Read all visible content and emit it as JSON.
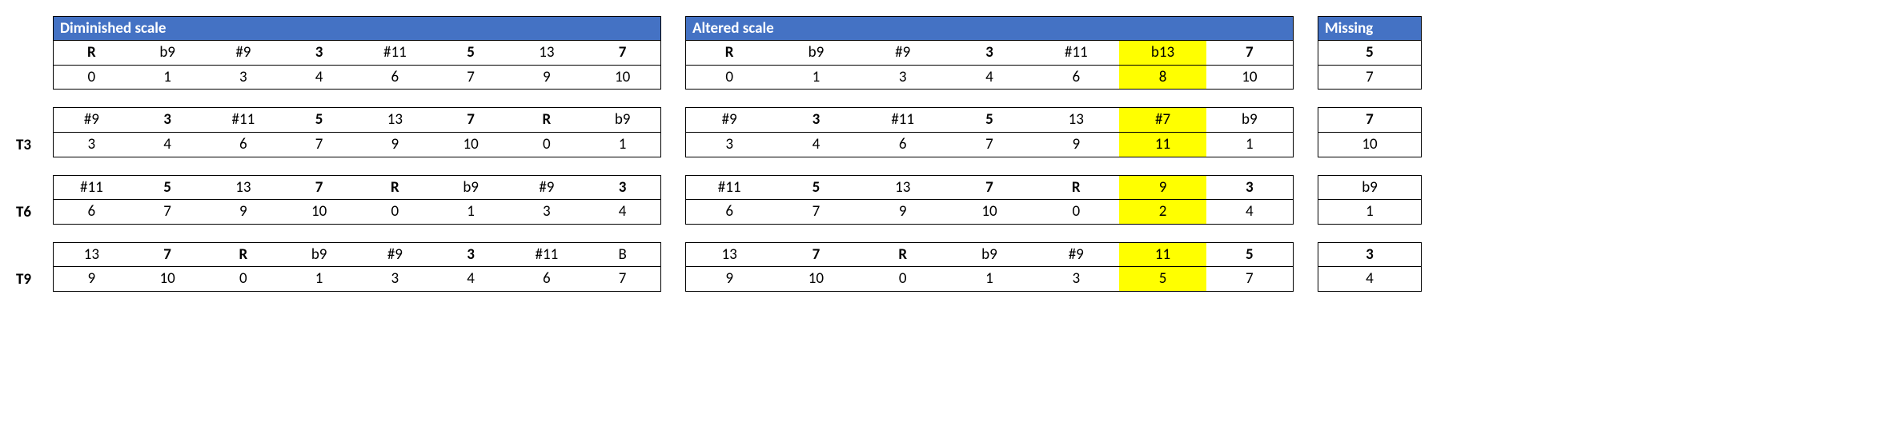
{
  "headers": {
    "diminished": "Diminished scale",
    "altered": "Altered scale",
    "missing": "Missing"
  },
  "row_labels": {
    "r0": "",
    "r1": "T3",
    "r2": "T6",
    "r3": "T9"
  },
  "groups": [
    {
      "label_key": "r0",
      "dim": {
        "top": [
          {
            "t": "R",
            "b": true
          },
          {
            "t": "b9"
          },
          {
            "t": "#9"
          },
          {
            "t": "3",
            "b": true
          },
          {
            "t": "#11"
          },
          {
            "t": "5",
            "b": true
          },
          {
            "t": "13"
          },
          {
            "t": "7",
            "b": true
          }
        ],
        "bot": [
          {
            "t": "0"
          },
          {
            "t": "1"
          },
          {
            "t": "3"
          },
          {
            "t": "4"
          },
          {
            "t": "6"
          },
          {
            "t": "7"
          },
          {
            "t": "9"
          },
          {
            "t": "10"
          }
        ]
      },
      "alt": {
        "top": [
          {
            "t": "R",
            "b": true
          },
          {
            "t": "b9"
          },
          {
            "t": "#9"
          },
          {
            "t": "3",
            "b": true
          },
          {
            "t": "#11"
          },
          {
            "t": "b13",
            "hl": true
          },
          {
            "t": "7",
            "b": true
          }
        ],
        "bot": [
          {
            "t": "0"
          },
          {
            "t": "1"
          },
          {
            "t": "3"
          },
          {
            "t": "4"
          },
          {
            "t": "6"
          },
          {
            "t": "8",
            "hl": true
          },
          {
            "t": "10"
          }
        ]
      },
      "miss": {
        "top": [
          {
            "t": "5",
            "b": true
          }
        ],
        "bot": [
          {
            "t": "7"
          }
        ]
      }
    },
    {
      "label_key": "r1",
      "dim": {
        "top": [
          {
            "t": "#9"
          },
          {
            "t": "3",
            "b": true
          },
          {
            "t": "#11"
          },
          {
            "t": "5",
            "b": true
          },
          {
            "t": "13"
          },
          {
            "t": "7",
            "b": true
          },
          {
            "t": "R",
            "b": true
          },
          {
            "t": "b9"
          }
        ],
        "bot": [
          {
            "t": "3"
          },
          {
            "t": "4"
          },
          {
            "t": "6"
          },
          {
            "t": "7"
          },
          {
            "t": "9"
          },
          {
            "t": "10"
          },
          {
            "t": "0"
          },
          {
            "t": "1"
          }
        ]
      },
      "alt": {
        "top": [
          {
            "t": "#9"
          },
          {
            "t": "3",
            "b": true
          },
          {
            "t": "#11"
          },
          {
            "t": "5",
            "b": true
          },
          {
            "t": "13"
          },
          {
            "t": "#7",
            "hl": true
          },
          {
            "t": "b9"
          }
        ],
        "bot": [
          {
            "t": "3"
          },
          {
            "t": "4"
          },
          {
            "t": "6"
          },
          {
            "t": "7"
          },
          {
            "t": "9"
          },
          {
            "t": "11",
            "hl": true
          },
          {
            "t": "1"
          }
        ]
      },
      "miss": {
        "top": [
          {
            "t": "7",
            "b": true
          }
        ],
        "bot": [
          {
            "t": "10"
          }
        ]
      }
    },
    {
      "label_key": "r2",
      "dim": {
        "top": [
          {
            "t": "#11"
          },
          {
            "t": "5",
            "b": true
          },
          {
            "t": "13"
          },
          {
            "t": "7",
            "b": true
          },
          {
            "t": "R",
            "b": true
          },
          {
            "t": "b9"
          },
          {
            "t": "#9"
          },
          {
            "t": "3",
            "b": true
          }
        ],
        "bot": [
          {
            "t": "6"
          },
          {
            "t": "7"
          },
          {
            "t": "9"
          },
          {
            "t": "10"
          },
          {
            "t": "0"
          },
          {
            "t": "1"
          },
          {
            "t": "3"
          },
          {
            "t": "4"
          }
        ]
      },
      "alt": {
        "top": [
          {
            "t": "#11"
          },
          {
            "t": "5",
            "b": true
          },
          {
            "t": "13"
          },
          {
            "t": "7",
            "b": true
          },
          {
            "t": "R",
            "b": true
          },
          {
            "t": "9",
            "hl": true
          },
          {
            "t": "3",
            "b": true
          }
        ],
        "bot": [
          {
            "t": "6"
          },
          {
            "t": "7"
          },
          {
            "t": "9"
          },
          {
            "t": "10"
          },
          {
            "t": "0"
          },
          {
            "t": "2",
            "hl": true
          },
          {
            "t": "4"
          }
        ]
      },
      "miss": {
        "top": [
          {
            "t": "b9"
          }
        ],
        "bot": [
          {
            "t": "1"
          }
        ]
      }
    },
    {
      "label_key": "r3",
      "dim": {
        "top": [
          {
            "t": "13"
          },
          {
            "t": "7",
            "b": true
          },
          {
            "t": "R",
            "b": true
          },
          {
            "t": "b9"
          },
          {
            "t": "#9"
          },
          {
            "t": "3",
            "b": true
          },
          {
            "t": "#11"
          },
          {
            "t": "B"
          }
        ],
        "bot": [
          {
            "t": "9"
          },
          {
            "t": "10"
          },
          {
            "t": "0"
          },
          {
            "t": "1"
          },
          {
            "t": "3"
          },
          {
            "t": "4"
          },
          {
            "t": "6"
          },
          {
            "t": "7"
          }
        ]
      },
      "alt": {
        "top": [
          {
            "t": "13"
          },
          {
            "t": "7",
            "b": true
          },
          {
            "t": "R",
            "b": true
          },
          {
            "t": "b9"
          },
          {
            "t": "#9"
          },
          {
            "t": "11",
            "hl": true
          },
          {
            "t": "5",
            "b": true
          }
        ],
        "bot": [
          {
            "t": "9"
          },
          {
            "t": "10"
          },
          {
            "t": "0"
          },
          {
            "t": "1"
          },
          {
            "t": "3"
          },
          {
            "t": "5",
            "hl": true
          },
          {
            "t": "7"
          }
        ]
      },
      "miss": {
        "top": [
          {
            "t": "3",
            "b": true
          }
        ],
        "bot": [
          {
            "t": "4"
          }
        ]
      }
    }
  ]
}
